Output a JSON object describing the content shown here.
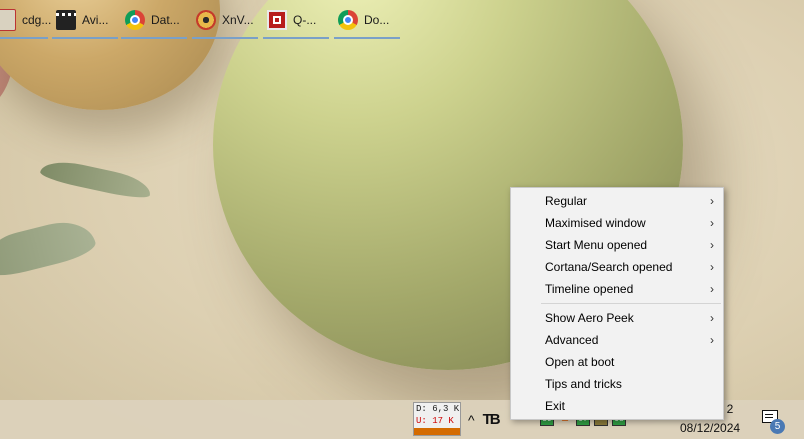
{
  "context_menu": {
    "items": [
      {
        "label": "Regular",
        "submenu": true
      },
      {
        "label": "Maximised window",
        "submenu": true
      },
      {
        "label": "Start Menu opened",
        "submenu": true
      },
      {
        "label": "Cortana/Search opened",
        "submenu": true
      },
      {
        "label": "Timeline opened",
        "submenu": true
      },
      {
        "label": "Show Aero Peek",
        "submenu": true
      },
      {
        "label": "Advanced",
        "submenu": true
      },
      {
        "label": "Open at boot",
        "submenu": false
      },
      {
        "label": "Tips and tricks",
        "submenu": false
      },
      {
        "label": "Exit",
        "submenu": false
      }
    ],
    "chevron": "›"
  },
  "taskbar": {
    "buttons": [
      {
        "label": "cdg...",
        "icon": "document-icon"
      },
      {
        "label": "Avi...",
        "icon": "clapperboard-icon"
      },
      {
        "label": "Dat...",
        "icon": "chrome-icon"
      },
      {
        "label": "XnV...",
        "icon": "xnview-eye-icon"
      },
      {
        "label": "Q-...",
        "icon": "q-dir-icon"
      },
      {
        "label": "Do...",
        "icon": "chrome-locked-icon"
      }
    ],
    "net_monitor": {
      "download": "D: 6,3 K",
      "upload": "U: 17 K"
    },
    "tray": {
      "overflow_glyph": "^",
      "logo_text": "TB",
      "indicators": [
        "59",
        "07",
        "08"
      ]
    },
    "clock": {
      "time": "2",
      "date": "08/12/2024"
    },
    "notifications": {
      "count": "5"
    }
  },
  "colors": {
    "menu_bg": "#f2f2f2",
    "taskbar_underline": "#7aa0c8",
    "badge": "#4a79b4"
  }
}
